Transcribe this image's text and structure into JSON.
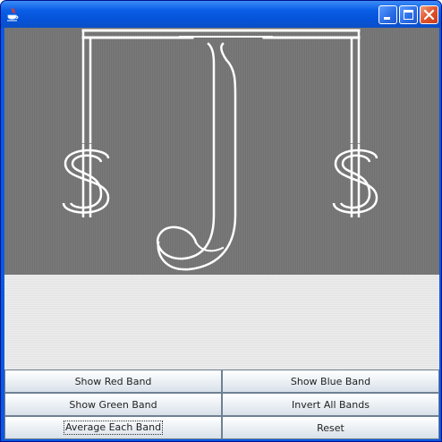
{
  "window": {
    "title": "",
    "controls": [
      "minimize",
      "maximize",
      "close"
    ]
  },
  "image_panel": {
    "description_colors": {
      "background": "#727272",
      "drawing": "#ffffff"
    }
  },
  "buttons": [
    {
      "label": "Show Red Band"
    },
    {
      "label": "Show Blue Band"
    },
    {
      "label": "Show Green Band"
    },
    {
      "label": "Invert All Bands"
    },
    {
      "label": "Average Each Band"
    },
    {
      "label": "Reset"
    }
  ]
}
